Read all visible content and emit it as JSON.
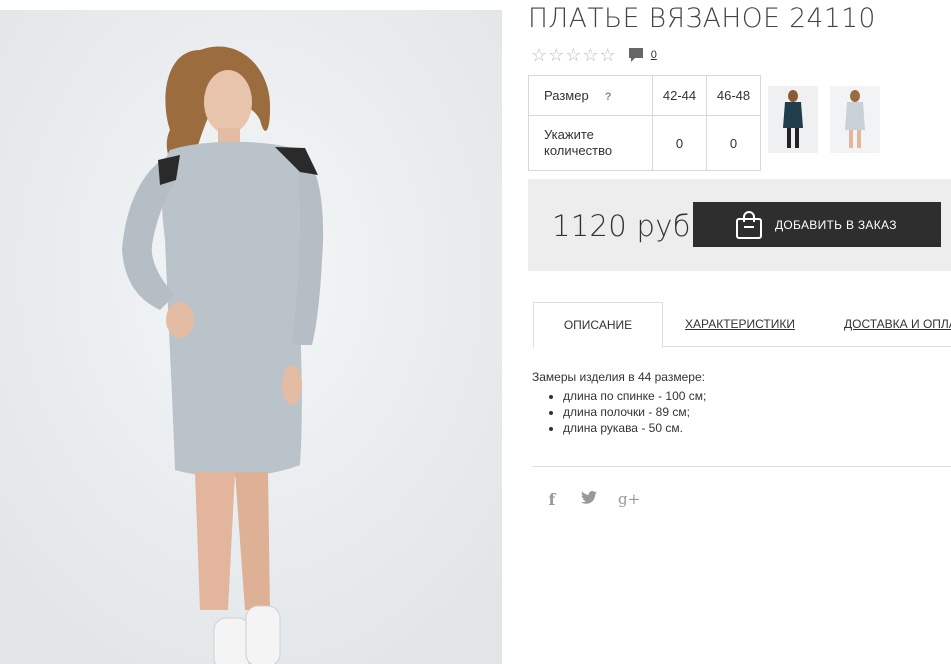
{
  "product": {
    "title": "ПЛАТЬЕ ВЯЗАНОЕ 24110",
    "rating_stars": 0,
    "comment_count": "0",
    "price": "1120 руб"
  },
  "sizes": {
    "size_label": "Размер",
    "help_mark": "?",
    "quantity_label": "Укажите количество",
    "columns": [
      "42-44",
      "46-48"
    ],
    "quantities": [
      "0",
      "0"
    ]
  },
  "buy": {
    "add_to_order_label": "ДОБАВИТЬ В ЗАКАЗ"
  },
  "tabs": [
    {
      "label": "ОПИСАНИЕ",
      "active": true
    },
    {
      "label": "ХАРАКТЕРИСТИКИ",
      "active": false
    },
    {
      "label": "ДОСТАВКА И ОПЛАТА",
      "active": false
    }
  ],
  "description": {
    "intro": "Замеры изделия в 44 размере:",
    "items": [
      "длина по спинке - 100 см;",
      "длина полочки - 89 см;",
      "длина рукава - 50 см."
    ]
  },
  "social": {
    "facebook": "f",
    "google_plus": "g+"
  },
  "colors": {
    "dress_grey": "#b9c3c9",
    "dark_button": "#2e2e2e",
    "buy_box_bg": "#ededed",
    "thumb_dark_dress": "#1f3d4a"
  }
}
